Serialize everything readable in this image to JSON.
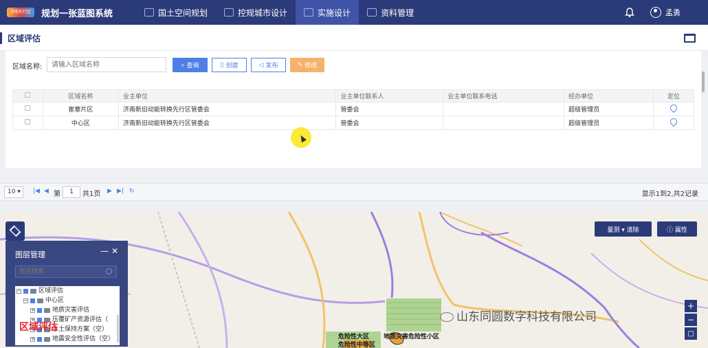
{
  "topbar": {
    "logo_text": "济南先行区",
    "system_title": "规划一张蓝图系统",
    "nav": [
      {
        "label": "国土空间规划",
        "active": false
      },
      {
        "label": "控规城市设计",
        "active": false
      },
      {
        "label": "实施设计",
        "active": true
      },
      {
        "label": "资料管理",
        "active": false
      }
    ],
    "username": "孟勇"
  },
  "panel": {
    "title": "区域评估"
  },
  "search": {
    "label": "区域名称:",
    "placeholder": "请输入区域名称"
  },
  "toolbar": {
    "query": "查询",
    "create": "创建",
    "publish": "发布",
    "edit": "修改"
  },
  "table": {
    "headers": [
      "区域名称",
      "业主单位",
      "业主单位联系人",
      "业主单位联系电话",
      "经办单位",
      "定位"
    ],
    "rows": [
      {
        "name": "崔寨片区",
        "owner": "济南新旧动能转换先行区管委会",
        "contact": "管委会",
        "phone": "",
        "handler": "超级管理员"
      },
      {
        "name": "中心区",
        "owner": "济南新旧动能转换先行区管委会",
        "contact": "管委会",
        "phone": "",
        "handler": "超级管理员"
      }
    ]
  },
  "pager": {
    "page_size": "10",
    "page_prefix": "第",
    "page_number": "1",
    "page_suffix": "共1页",
    "record_info": "显示1到2,共2记录"
  },
  "map": {
    "measure_label": "量测 ▾  清除",
    "attr_label": "属性",
    "zoom_in": "+",
    "zoom_out": "−",
    "fullscreen": "□",
    "layer_panel": {
      "title": "图层管理",
      "search_placeholder": "图层搜索",
      "tree": [
        {
          "label": "区域评估",
          "level": 0
        },
        {
          "label": "中心区",
          "level": 1
        },
        {
          "label": "地质灾害评估",
          "level": 2
        },
        {
          "label": "压覆矿产资源评估（",
          "level": 2
        },
        {
          "label": "水土保持方案（空）",
          "level": 2
        },
        {
          "label": "地震安全性评估（空）",
          "level": 2
        }
      ]
    },
    "overlay_label": "区域评估",
    "watermark": "山东同圆数字科技有限公司",
    "labels": {
      "zone_big": "危险性大区",
      "zone_medium": "危险性中等区",
      "zone_small": "地质灾害危险性小区"
    }
  }
}
